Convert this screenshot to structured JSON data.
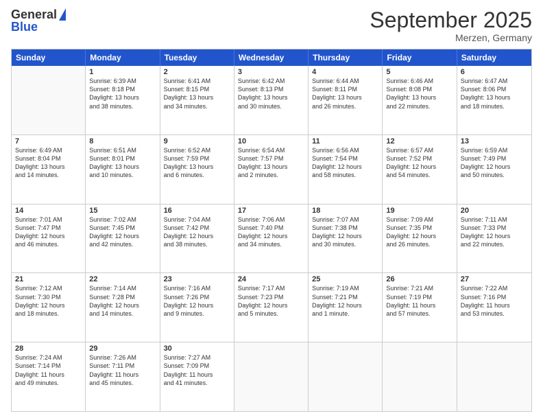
{
  "header": {
    "logo_line1": "General",
    "logo_line2": "Blue",
    "title": "September 2025",
    "subtitle": "Merzen, Germany"
  },
  "calendar": {
    "weekdays": [
      "Sunday",
      "Monday",
      "Tuesday",
      "Wednesday",
      "Thursday",
      "Friday",
      "Saturday"
    ],
    "rows": [
      [
        {
          "day": "",
          "info": ""
        },
        {
          "day": "1",
          "info": "Sunrise: 6:39 AM\nSunset: 8:18 PM\nDaylight: 13 hours\nand 38 minutes."
        },
        {
          "day": "2",
          "info": "Sunrise: 6:41 AM\nSunset: 8:15 PM\nDaylight: 13 hours\nand 34 minutes."
        },
        {
          "day": "3",
          "info": "Sunrise: 6:42 AM\nSunset: 8:13 PM\nDaylight: 13 hours\nand 30 minutes."
        },
        {
          "day": "4",
          "info": "Sunrise: 6:44 AM\nSunset: 8:11 PM\nDaylight: 13 hours\nand 26 minutes."
        },
        {
          "day": "5",
          "info": "Sunrise: 6:46 AM\nSunset: 8:08 PM\nDaylight: 13 hours\nand 22 minutes."
        },
        {
          "day": "6",
          "info": "Sunrise: 6:47 AM\nSunset: 8:06 PM\nDaylight: 13 hours\nand 18 minutes."
        }
      ],
      [
        {
          "day": "7",
          "info": "Sunrise: 6:49 AM\nSunset: 8:04 PM\nDaylight: 13 hours\nand 14 minutes."
        },
        {
          "day": "8",
          "info": "Sunrise: 6:51 AM\nSunset: 8:01 PM\nDaylight: 13 hours\nand 10 minutes."
        },
        {
          "day": "9",
          "info": "Sunrise: 6:52 AM\nSunset: 7:59 PM\nDaylight: 13 hours\nand 6 minutes."
        },
        {
          "day": "10",
          "info": "Sunrise: 6:54 AM\nSunset: 7:57 PM\nDaylight: 13 hours\nand 2 minutes."
        },
        {
          "day": "11",
          "info": "Sunrise: 6:56 AM\nSunset: 7:54 PM\nDaylight: 12 hours\nand 58 minutes."
        },
        {
          "day": "12",
          "info": "Sunrise: 6:57 AM\nSunset: 7:52 PM\nDaylight: 12 hours\nand 54 minutes."
        },
        {
          "day": "13",
          "info": "Sunrise: 6:59 AM\nSunset: 7:49 PM\nDaylight: 12 hours\nand 50 minutes."
        }
      ],
      [
        {
          "day": "14",
          "info": "Sunrise: 7:01 AM\nSunset: 7:47 PM\nDaylight: 12 hours\nand 46 minutes."
        },
        {
          "day": "15",
          "info": "Sunrise: 7:02 AM\nSunset: 7:45 PM\nDaylight: 12 hours\nand 42 minutes."
        },
        {
          "day": "16",
          "info": "Sunrise: 7:04 AM\nSunset: 7:42 PM\nDaylight: 12 hours\nand 38 minutes."
        },
        {
          "day": "17",
          "info": "Sunrise: 7:06 AM\nSunset: 7:40 PM\nDaylight: 12 hours\nand 34 minutes."
        },
        {
          "day": "18",
          "info": "Sunrise: 7:07 AM\nSunset: 7:38 PM\nDaylight: 12 hours\nand 30 minutes."
        },
        {
          "day": "19",
          "info": "Sunrise: 7:09 AM\nSunset: 7:35 PM\nDaylight: 12 hours\nand 26 minutes."
        },
        {
          "day": "20",
          "info": "Sunrise: 7:11 AM\nSunset: 7:33 PM\nDaylight: 12 hours\nand 22 minutes."
        }
      ],
      [
        {
          "day": "21",
          "info": "Sunrise: 7:12 AM\nSunset: 7:30 PM\nDaylight: 12 hours\nand 18 minutes."
        },
        {
          "day": "22",
          "info": "Sunrise: 7:14 AM\nSunset: 7:28 PM\nDaylight: 12 hours\nand 14 minutes."
        },
        {
          "day": "23",
          "info": "Sunrise: 7:16 AM\nSunset: 7:26 PM\nDaylight: 12 hours\nand 9 minutes."
        },
        {
          "day": "24",
          "info": "Sunrise: 7:17 AM\nSunset: 7:23 PM\nDaylight: 12 hours\nand 5 minutes."
        },
        {
          "day": "25",
          "info": "Sunrise: 7:19 AM\nSunset: 7:21 PM\nDaylight: 12 hours\nand 1 minute."
        },
        {
          "day": "26",
          "info": "Sunrise: 7:21 AM\nSunset: 7:19 PM\nDaylight: 11 hours\nand 57 minutes."
        },
        {
          "day": "27",
          "info": "Sunrise: 7:22 AM\nSunset: 7:16 PM\nDaylight: 11 hours\nand 53 minutes."
        }
      ],
      [
        {
          "day": "28",
          "info": "Sunrise: 7:24 AM\nSunset: 7:14 PM\nDaylight: 11 hours\nand 49 minutes."
        },
        {
          "day": "29",
          "info": "Sunrise: 7:26 AM\nSunset: 7:11 PM\nDaylight: 11 hours\nand 45 minutes."
        },
        {
          "day": "30",
          "info": "Sunrise: 7:27 AM\nSunset: 7:09 PM\nDaylight: 11 hours\nand 41 minutes."
        },
        {
          "day": "",
          "info": ""
        },
        {
          "day": "",
          "info": ""
        },
        {
          "day": "",
          "info": ""
        },
        {
          "day": "",
          "info": ""
        }
      ]
    ]
  }
}
